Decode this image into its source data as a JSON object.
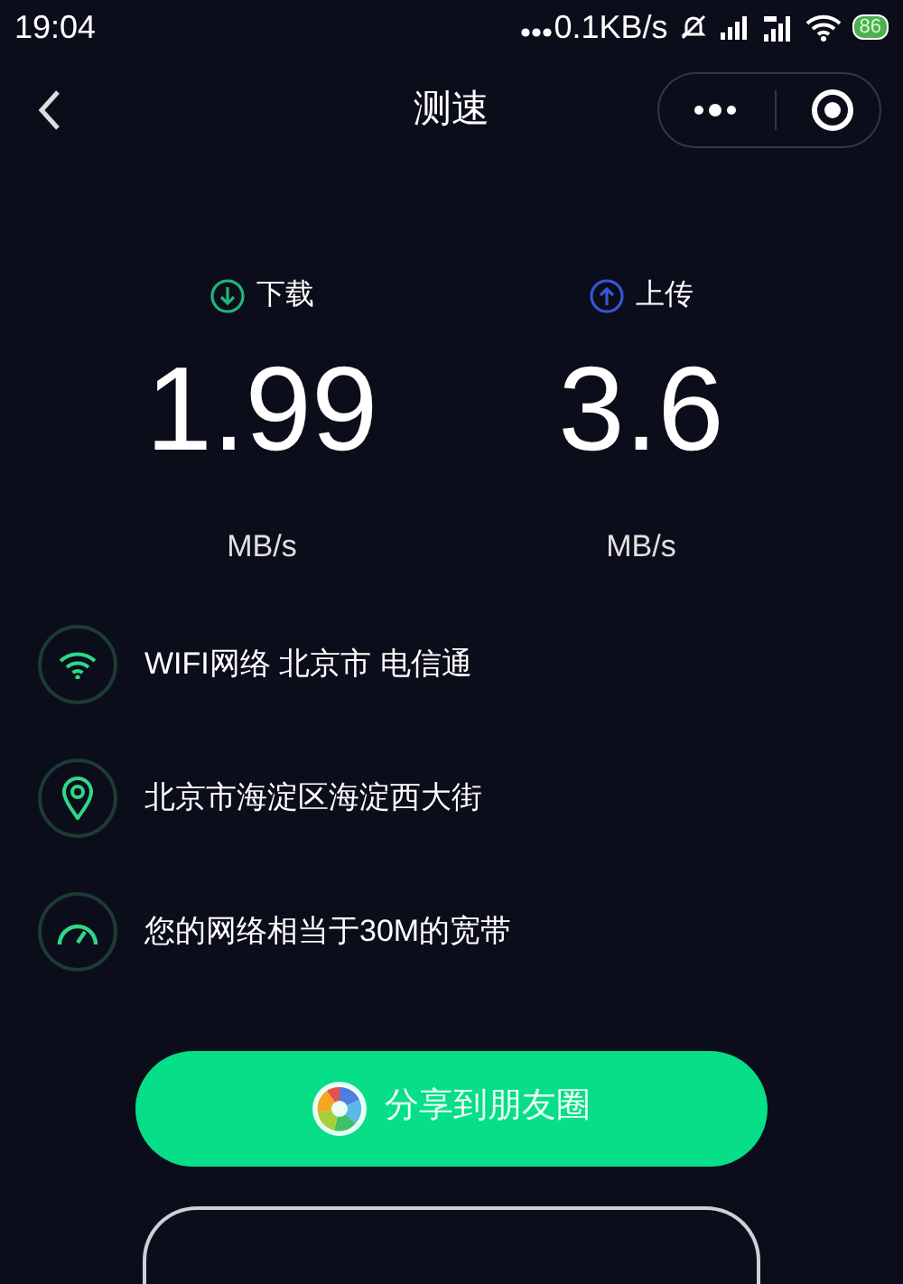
{
  "status_bar": {
    "time": "19:04",
    "net_speed": "0.1KB/s",
    "battery": "86"
  },
  "header": {
    "title": "测速"
  },
  "stats": [
    {
      "kind": "download",
      "label": "下载",
      "value": "1.99",
      "unit": "MB/s"
    },
    {
      "kind": "upload",
      "label": "上传",
      "value": "3.6",
      "unit": "MB/s"
    }
  ],
  "info": [
    {
      "kind": "wifi",
      "text": "WIFI网络 北京市 电信通"
    },
    {
      "kind": "location",
      "text": "北京市海淀区海淀西大街"
    },
    {
      "kind": "speed",
      "text": "您的网络相当于30M的宽带"
    }
  ],
  "share_button": {
    "label": "分享到朋友圈"
  }
}
